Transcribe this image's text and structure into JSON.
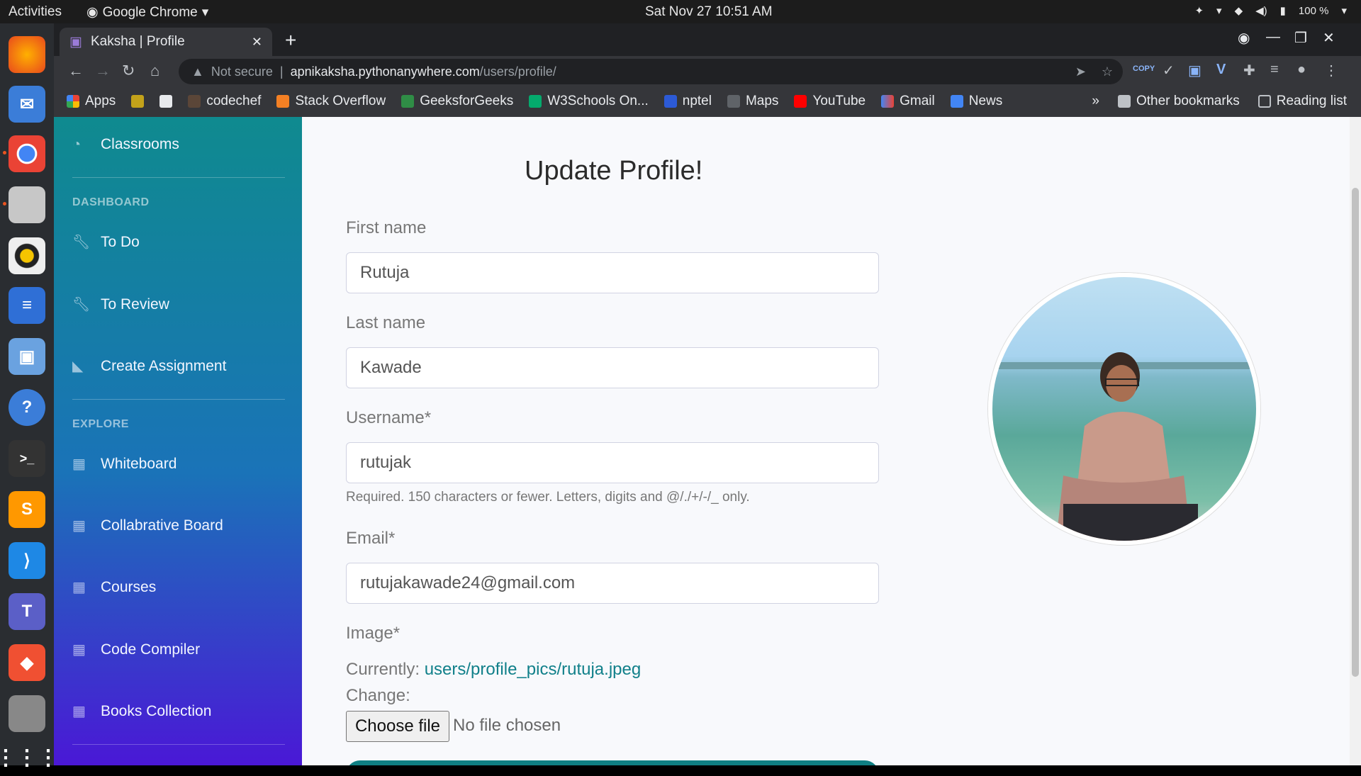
{
  "topbar": {
    "activities": "Activities",
    "app_name": "Google Chrome",
    "clock": "Sat Nov 27  10:51 AM",
    "battery": "100 %"
  },
  "browser": {
    "tab_title": "Kaksha | Profile",
    "url_security": "Not secure",
    "url_host": "apnikaksha.pythonanywhere.com",
    "url_path": "/users/profile/",
    "bookmarks": [
      "Apps",
      "codechef",
      "Stack Overflow",
      "GeeksforGeeks",
      "W3Schools On...",
      "nptel",
      "Maps",
      "YouTube",
      "Gmail",
      "News"
    ],
    "other_bookmarks": "Other bookmarks",
    "reading_list": "Reading list",
    "copy_badge": "COPY"
  },
  "sidebar": {
    "classrooms": "Classrooms",
    "heading_dashboard": "DASHBOARD",
    "todo": "To Do",
    "to_review": "To Review",
    "create_assignment": "Create Assignment",
    "heading_explore": "EXPLORE",
    "whiteboard": "Whiteboard",
    "collab": "Collabrative Board",
    "courses": "Courses",
    "compiler": "Code Compiler",
    "books": "Books Collection"
  },
  "form": {
    "title": "Update Profile!",
    "first_name_label": "First name",
    "first_name": "Rutuja",
    "last_name_label": "Last name",
    "last_name": "Kawade",
    "username_label": "Username*",
    "username": "rutujak",
    "username_help": "Required. 150 characters or fewer. Letters, digits and @/./+/-/_ only.",
    "email_label": "Email*",
    "email": "rutujakawade24@gmail.com",
    "image_label": "Image*",
    "currently_label": "Currently:",
    "current_image": "users/profile_pics/rutuja.jpeg",
    "change_label": "Change:",
    "choose_file": "Choose file",
    "no_file": "No file chosen"
  }
}
